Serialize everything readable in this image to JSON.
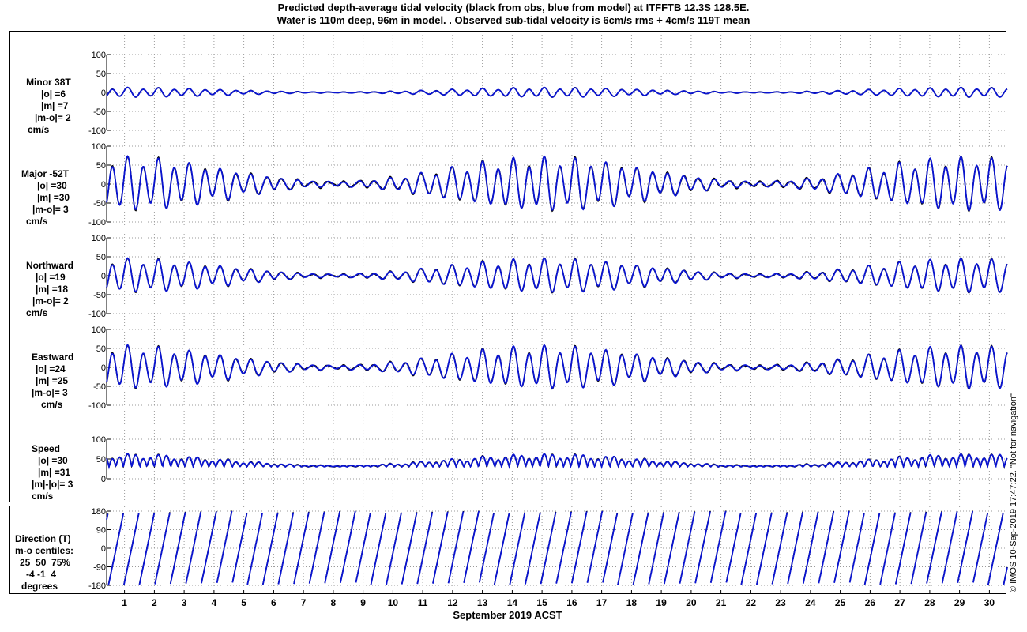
{
  "header": {
    "title_line1": "Predicted depth-average tidal velocity (black from obs, blue from model) at ITFFTB 12.3S 128.5E.",
    "title_line2": "Water is 110m deep, 96m in model. . Observed sub-tidal velocity is 6cm/s rms + 4cm/s 119T mean"
  },
  "credit": "© IMOS 10-Sep-2019 17:47:22. \"Not for navigation\"",
  "colors": {
    "obs": "#000000",
    "model": "#0a14d2",
    "grid": "#9a9a9a"
  },
  "chart_data": {
    "type": "line",
    "xlabel": "September 2019 ACST",
    "x_ticks": [
      "1",
      "2",
      "3",
      "4",
      "5",
      "6",
      "7",
      "8",
      "9",
      "10",
      "11",
      "12",
      "13",
      "14",
      "15",
      "16",
      "17",
      "18",
      "19",
      "20",
      "21",
      "22",
      "23",
      "24",
      "25",
      "26",
      "27",
      "28",
      "29",
      "30"
    ],
    "xlim_days": [
      0.4,
      30.6
    ],
    "series_legend": [
      "black from obs",
      "blue from model"
    ],
    "panels": [
      {
        "key": "minor",
        "label": [
          "Minor 38T",
          "|o| =6",
          "|m| =7",
          "|m-o|= 2",
          "cm/s"
        ],
        "yticks": [
          "100",
          "50",
          "0",
          "-50",
          "-100"
        ],
        "ylim": [
          -100,
          100
        ],
        "amplitude": 12,
        "offset": 0
      },
      {
        "key": "major",
        "label": [
          "Major -52T",
          "|o| =30",
          "|m| =30",
          "|m-o|= 3",
          "cm/s"
        ],
        "yticks": [
          "100",
          "50",
          "0",
          "-50",
          "-100"
        ],
        "ylim": [
          -100,
          100
        ],
        "amplitude": 60,
        "offset": 0
      },
      {
        "key": "north",
        "label": [
          "Northward",
          "|o| =19",
          "|m| =18",
          "|m-o|= 2",
          "cm/s"
        ],
        "yticks": [
          "100",
          "50",
          "0",
          "-50",
          "-100"
        ],
        "ylim": [
          -100,
          100
        ],
        "amplitude": 38,
        "offset": 0
      },
      {
        "key": "east",
        "label": [
          "Eastward",
          "|o| =24",
          "|m| =25",
          "|m-o|= 3",
          "cm/s"
        ],
        "yticks": [
          "100",
          "50",
          "0",
          "-50",
          "-100"
        ],
        "ylim": [
          -100,
          100
        ],
        "amplitude": 48,
        "offset": 0
      },
      {
        "key": "speed",
        "label": [
          "Speed",
          "|o| =30",
          "|m| =31",
          "|m|-|o|= 3",
          "cm/s"
        ],
        "yticks": [
          "100",
          "50",
          "0"
        ],
        "ylim": [
          0,
          100
        ],
        "amplitude": 30,
        "offset": 30
      },
      {
        "key": "direction",
        "label": [
          "Direction (T)",
          "m-o centiles:",
          "25  50  75%",
          "-4 -1  4",
          "degrees"
        ],
        "yticks": [
          "180",
          "90",
          "0",
          "-90",
          "-180"
        ],
        "ylim": [
          -180,
          180
        ]
      }
    ]
  }
}
